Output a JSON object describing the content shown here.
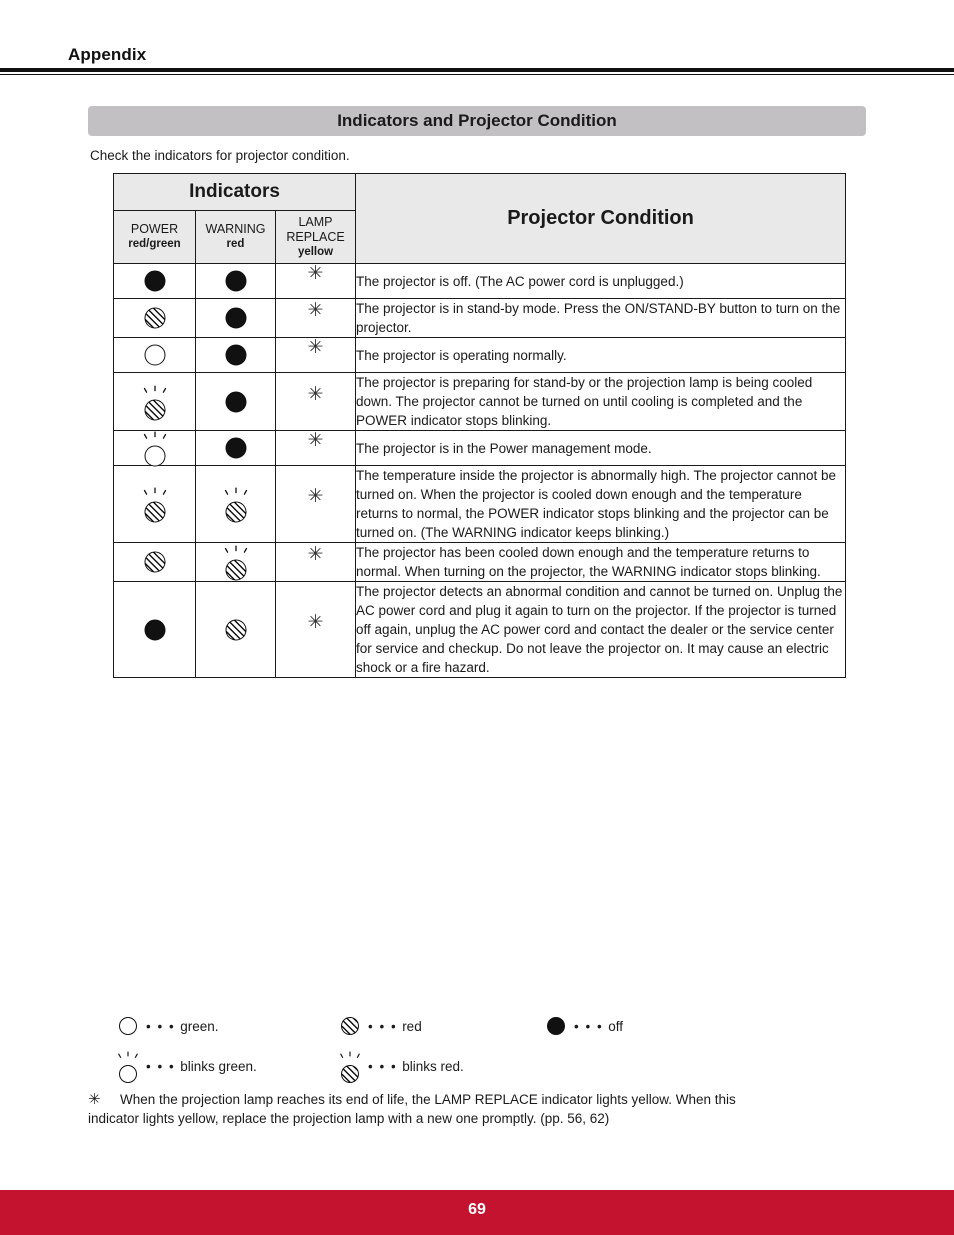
{
  "header": {
    "running_head": "Appendix"
  },
  "section": {
    "title": "Indicators and Projector Condition",
    "intro": "Check the indicators for projector condition."
  },
  "table": {
    "group_header": "Indicators",
    "condition_header": "Projector Condition",
    "columns": [
      {
        "name": "POWER",
        "color": "red/green"
      },
      {
        "name": "WARNING",
        "color": "red"
      },
      {
        "name": "LAMP REPLACE",
        "name_line1": "LAMP",
        "name_line2": "REPLACE",
        "color": "yellow"
      }
    ],
    "rows": [
      {
        "power": "off",
        "warning": "off",
        "lamp": "asterisk",
        "description": "The projector is off. (The AC power cord is unplugged.)"
      },
      {
        "power": "red",
        "warning": "off",
        "lamp": "asterisk",
        "description": "The projector is in stand-by mode. Press the ON/STAND-BY button to turn on the projector."
      },
      {
        "power": "green",
        "warning": "off",
        "lamp": "asterisk",
        "description": "The projector is operating normally."
      },
      {
        "power": "blinks-red",
        "warning": "off",
        "lamp": "asterisk",
        "description": "The projector is preparing for stand-by or the projection lamp is being cooled down. The projector cannot be turned on until cooling is completed and the POWER indicator stops blinking."
      },
      {
        "power": "blinks-green",
        "warning": "off",
        "lamp": "asterisk",
        "description": "The projector is in the Power management mode."
      },
      {
        "power": "blinks-red",
        "warning": "blinks-red",
        "lamp": "asterisk",
        "description": "The temperature inside the projector is abnormally high. The projector cannot be turned on. When the projector is cooled down enough and the temperature returns to normal, the POWER indicator stops blinking and the projector can be turned on. (The WARNING indicator keeps blinking.)"
      },
      {
        "power": "red",
        "warning": "blinks-red",
        "lamp": "asterisk",
        "description": "The projector has been cooled down enough and the temperature returns to normal. When turning on the projector, the WARNING indicator stops blinking."
      },
      {
        "power": "off",
        "warning": "red",
        "lamp": "asterisk",
        "description": "The projector detects an abnormal condition and cannot be turned on. Unplug the AC power cord and plug it again to turn on the projector. If the projector is turned off again, unplug the AC power cord and contact the dealer or the service center for service and checkup. Do not leave the projector on. It may cause an electric shock or a fire hazard."
      }
    ]
  },
  "legend": {
    "dots": "• • •",
    "items": [
      {
        "symbol": "green",
        "label": "green."
      },
      {
        "symbol": "red",
        "label": "red"
      },
      {
        "symbol": "off",
        "label": "off"
      },
      {
        "symbol": "blinks-green",
        "label": "blinks green."
      },
      {
        "symbol": "blinks-red",
        "label": "blinks red."
      }
    ]
  },
  "footnote": {
    "mark": "✳",
    "line1": "When the projection lamp reaches its end of life, the LAMP REPLACE indicator lights yellow. When this",
    "line2": "indicator lights yellow, replace the projection lamp with a new one promptly. (pp. 56, 62)"
  },
  "footer": {
    "page_number": "69",
    "bar_color": "#c4132f"
  }
}
